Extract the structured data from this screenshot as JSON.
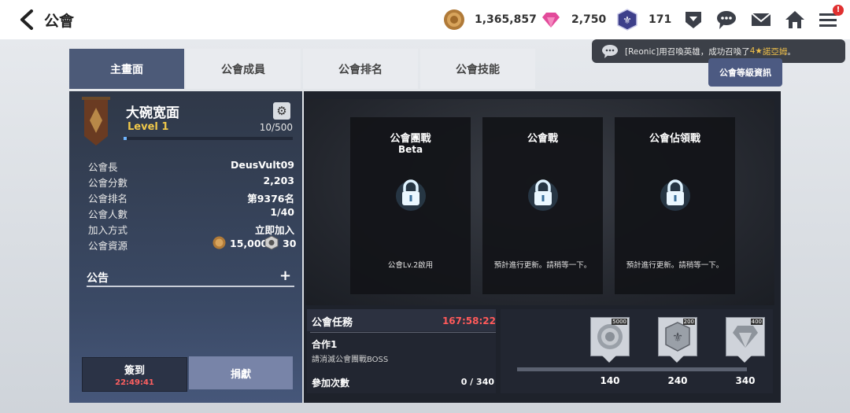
{
  "header": {
    "title": "公會",
    "gold": "1,365,857",
    "gems": "2,750",
    "emblem": "171",
    "badge": "!"
  },
  "tabs": [
    {
      "label": "主畫面"
    },
    {
      "label": "公會成員"
    },
    {
      "label": "公會排名"
    },
    {
      "label": "公會技能"
    }
  ],
  "toast": {
    "prefix": "[Reonic]用召喚英雄，成功召喚了",
    "stars": "4★",
    "hero": "諾亞姆",
    "suffix": "。"
  },
  "level_info_button": "公會等級資訊",
  "guild": {
    "name": "大碗宽面",
    "level": "Level 1",
    "exp": "10/500",
    "exp_progress": 0.02,
    "stats": [
      {
        "label": "公會長",
        "value": "DeusVult09"
      },
      {
        "label": "公會分數",
        "value": "2,203"
      },
      {
        "label": "公會排名",
        "value": "第9376名"
      },
      {
        "label": "公會人數",
        "value": "1/40"
      },
      {
        "label": "加入方式",
        "value": "立即加入"
      }
    ],
    "resources_label": "公會資源",
    "resource_gold": "15,000",
    "resource_emblem": "30",
    "notice_label": "公告",
    "notice_add": "+"
  },
  "actions": {
    "signin": "簽到",
    "signin_timer": "22:49:41",
    "donate": "捐獻"
  },
  "modes": [
    {
      "title": "公會團戰",
      "sub": "Beta",
      "note": "公會Lv.2啟用"
    },
    {
      "title": "公會戰",
      "sub": "",
      "note": "預計進行更新。請稍等一下。"
    },
    {
      "title": "公會佔領戰",
      "sub": "",
      "note": "預計進行更新。請稍等一下。"
    }
  ],
  "quest": {
    "title": "公會任務",
    "timer": "167:58:22",
    "name": "合作1",
    "desc": "請消滅公會團戰BOSS",
    "count_label": "參加次數",
    "count_value": "0 / 340"
  },
  "rewards": [
    {
      "amount": "5000",
      "milestone": "140",
      "icon": "gold-coin-icon"
    },
    {
      "amount": "200",
      "milestone": "240",
      "icon": "guild-emblem-icon"
    },
    {
      "amount": "400",
      "milestone": "340",
      "icon": "diamond-icon"
    }
  ]
}
